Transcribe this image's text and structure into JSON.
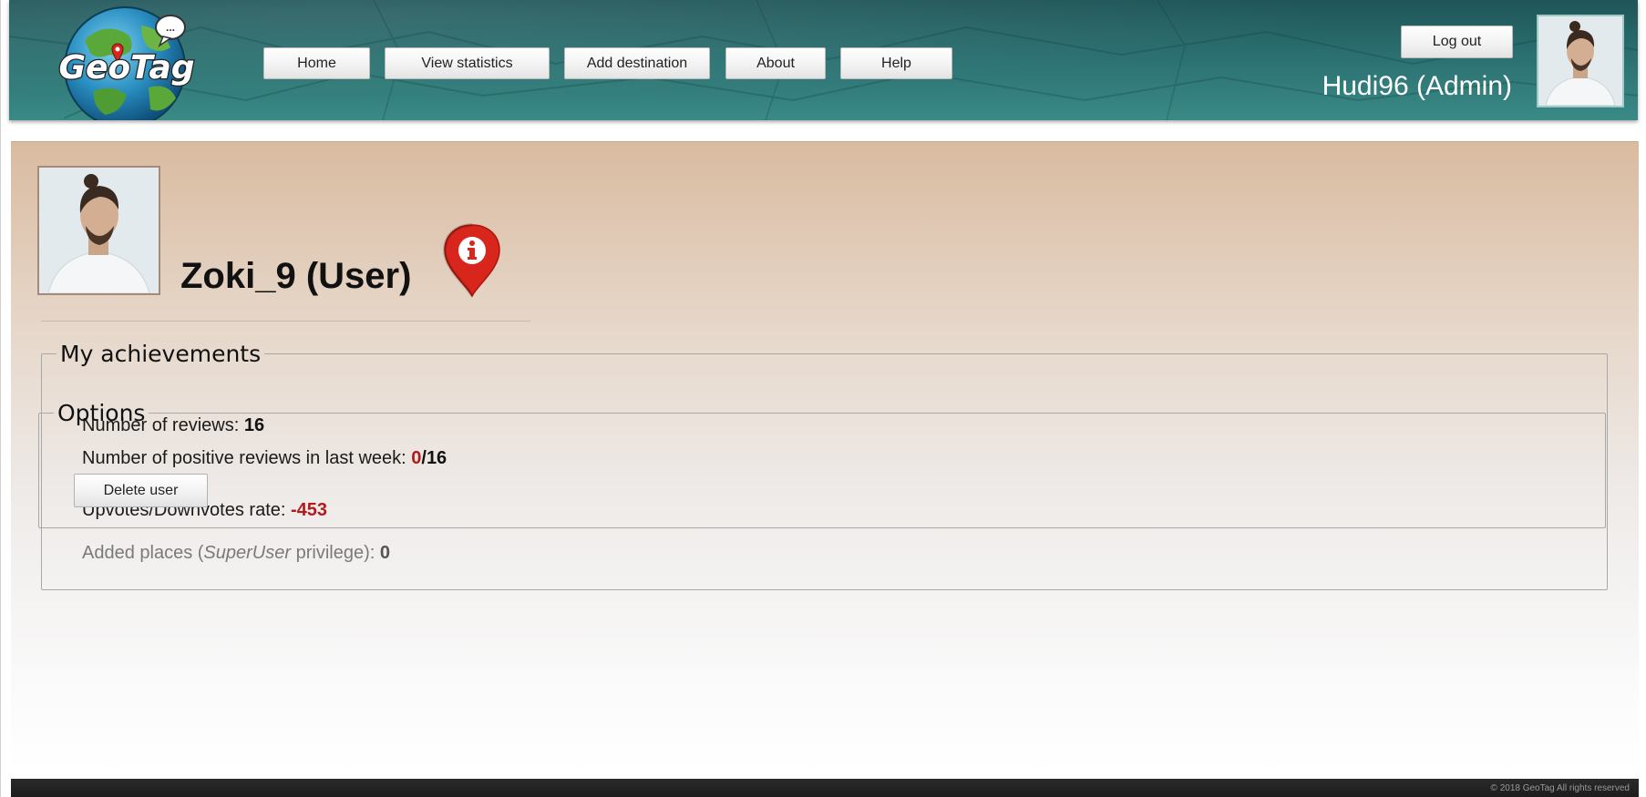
{
  "header": {
    "logo_text": "GeoTag",
    "nav": {
      "home": "Home",
      "view_statistics": "View statistics",
      "add_destination": "Add destination",
      "about": "About",
      "help": "Help"
    },
    "logout_label": "Log out",
    "current_user": "Hudi96 (Admin)"
  },
  "profile": {
    "name": "Zoki_9 (User)"
  },
  "achievements": {
    "legend": "My achievements",
    "reviews_label": "Number of reviews: ",
    "reviews_value": "16",
    "positive_label": "Number of positive reviews in last week: ",
    "positive_value": "0",
    "positive_sep": "/",
    "positive_total": "16",
    "rate_label": "Upvotes/Downvotes rate: ",
    "rate_value": "-453",
    "places_label_start": "Added places (",
    "places_label_role": "SuperUser",
    "places_label_end": " privilege): ",
    "places_value": "0"
  },
  "options": {
    "legend": "Options",
    "delete_label": "Delete user"
  },
  "footer": {
    "copyright": "© 2018 GeoTag All rights reserved"
  },
  "colors": {
    "header_teal": "#2b6f70",
    "accent_red": "#b11b1b",
    "pin_red": "#d9261c"
  },
  "icons": {
    "info_pin": "info-pin-icon",
    "logo_globe": "globe-logo"
  }
}
